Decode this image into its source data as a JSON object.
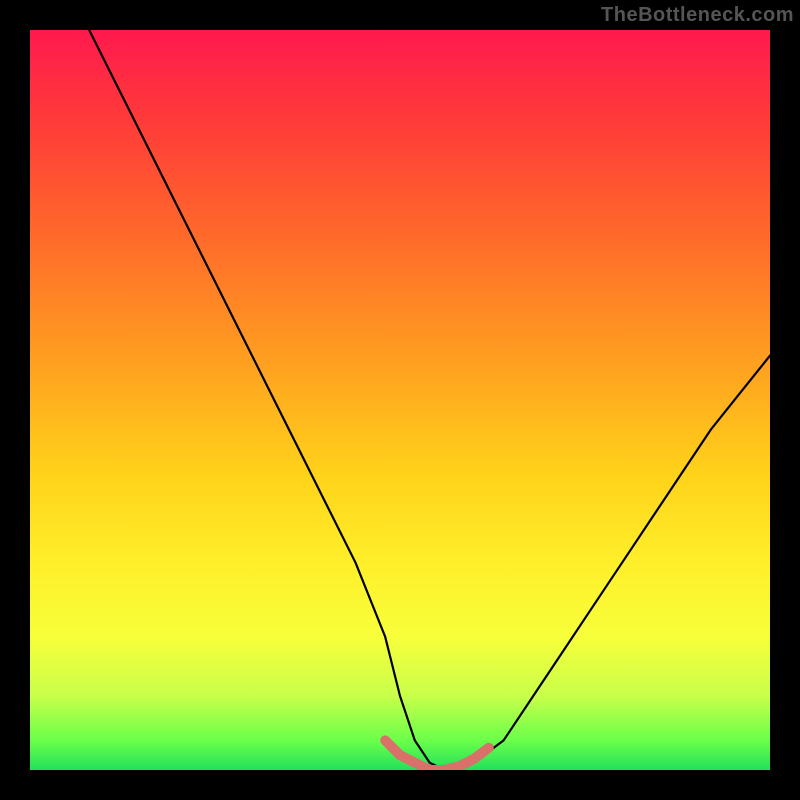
{
  "watermark": "TheBottleneck.com",
  "chart_data": {
    "type": "line",
    "title": "",
    "xlabel": "",
    "ylabel": "",
    "xlim": [
      0,
      100
    ],
    "ylim": [
      0,
      100
    ],
    "note": "Axes have no visible ticks or labels; values are relative percentages of the plot area. y=0 (bottom, green) = optimal; y=100 (top, red) = worst.",
    "series": [
      {
        "name": "bottleneck-curve",
        "color": "#000000",
        "x": [
          8,
          12,
          16,
          20,
          24,
          28,
          32,
          36,
          40,
          44,
          48,
          50,
          52,
          54,
          56,
          58,
          60,
          64,
          68,
          72,
          76,
          80,
          84,
          88,
          92,
          96,
          100
        ],
        "y": [
          100,
          92,
          84,
          76,
          68,
          60,
          52,
          44,
          36,
          28,
          18,
          10,
          4,
          1,
          0,
          0,
          1,
          4,
          10,
          16,
          22,
          28,
          34,
          40,
          46,
          51,
          56
        ]
      },
      {
        "name": "optimal-band",
        "color": "#d9706a",
        "x": [
          48,
          50,
          52,
          54,
          56,
          58,
          60,
          62
        ],
        "y": [
          4,
          2,
          1,
          0,
          0,
          0.5,
          1.5,
          3
        ]
      }
    ],
    "gradient_stops": [
      {
        "pos": 0.0,
        "color": "#ff1a4d"
      },
      {
        "pos": 0.12,
        "color": "#ff3a3a"
      },
      {
        "pos": 0.28,
        "color": "#ff6a2a"
      },
      {
        "pos": 0.45,
        "color": "#ffa020"
      },
      {
        "pos": 0.6,
        "color": "#ffd21a"
      },
      {
        "pos": 0.72,
        "color": "#ffef2a"
      },
      {
        "pos": 0.82,
        "color": "#f7ff3a"
      },
      {
        "pos": 0.9,
        "color": "#c8ff4a"
      },
      {
        "pos": 0.96,
        "color": "#6bff4a"
      },
      {
        "pos": 1.0,
        "color": "#22e05a"
      }
    ]
  }
}
